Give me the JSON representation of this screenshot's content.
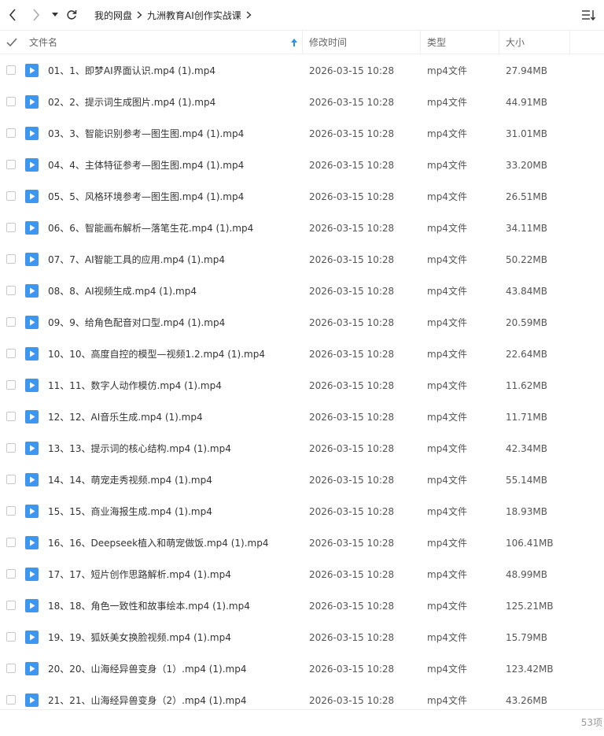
{
  "toolbar": {
    "breadcrumb": [
      "我的网盘",
      "九洲教育AI创作实战课"
    ]
  },
  "columns": {
    "name": "文件名",
    "modified": "修改时间",
    "type": "类型",
    "size": "大小"
  },
  "colors": {
    "accent": "#2b8ff0",
    "icon_blue": "#3e95f2"
  },
  "files": [
    {
      "name": "01、1、即梦AI界面认识.mp4 (1).mp4",
      "modified": "2026-03-15 10:28",
      "type": "mp4文件",
      "size": "27.94MB"
    },
    {
      "name": "02、2、提示词生成图片.mp4 (1).mp4",
      "modified": "2026-03-15 10:28",
      "type": "mp4文件",
      "size": "44.91MB"
    },
    {
      "name": "03、3、智能识别参考—图生图.mp4 (1).mp4",
      "modified": "2026-03-15 10:28",
      "type": "mp4文件",
      "size": "31.01MB"
    },
    {
      "name": "04、4、主体特征参考—图生图.mp4 (1).mp4",
      "modified": "2026-03-15 10:28",
      "type": "mp4文件",
      "size": "33.20MB"
    },
    {
      "name": "05、5、风格环境参考—图生图.mp4 (1).mp4",
      "modified": "2026-03-15 10:28",
      "type": "mp4文件",
      "size": "26.51MB"
    },
    {
      "name": "06、6、智能画布解析—落笔生花.mp4 (1).mp4",
      "modified": "2026-03-15 10:28",
      "type": "mp4文件",
      "size": "34.11MB"
    },
    {
      "name": "07、7、AI智能工具的应用.mp4 (1).mp4",
      "modified": "2026-03-15 10:28",
      "type": "mp4文件",
      "size": "50.22MB"
    },
    {
      "name": "08、8、AI视频生成.mp4 (1).mp4",
      "modified": "2026-03-15 10:28",
      "type": "mp4文件",
      "size": "43.84MB"
    },
    {
      "name": "09、9、给角色配音对口型.mp4 (1).mp4",
      "modified": "2026-03-15 10:28",
      "type": "mp4文件",
      "size": "20.59MB"
    },
    {
      "name": "10、10、高度自控的模型—视频1.2.mp4 (1).mp4",
      "modified": "2026-03-15 10:28",
      "type": "mp4文件",
      "size": "22.64MB"
    },
    {
      "name": "11、11、数字人动作模仿.mp4 (1).mp4",
      "modified": "2026-03-15 10:28",
      "type": "mp4文件",
      "size": "11.62MB"
    },
    {
      "name": "12、12、AI音乐生成.mp4 (1).mp4",
      "modified": "2026-03-15 10:28",
      "type": "mp4文件",
      "size": "11.71MB"
    },
    {
      "name": "13、13、提示词的核心结构.mp4 (1).mp4",
      "modified": "2026-03-15 10:28",
      "type": "mp4文件",
      "size": "42.34MB"
    },
    {
      "name": "14、14、萌宠走秀视频.mp4 (1).mp4",
      "modified": "2026-03-15 10:28",
      "type": "mp4文件",
      "size": "55.14MB"
    },
    {
      "name": "15、15、商业海报生成.mp4 (1).mp4",
      "modified": "2026-03-15 10:28",
      "type": "mp4文件",
      "size": "18.93MB"
    },
    {
      "name": "16、16、Deepseek植入和萌宠做饭.mp4 (1).mp4",
      "modified": "2026-03-15 10:28",
      "type": "mp4文件",
      "size": "106.41MB"
    },
    {
      "name": "17、17、短片创作思路解析.mp4 (1).mp4",
      "modified": "2026-03-15 10:28",
      "type": "mp4文件",
      "size": "48.99MB"
    },
    {
      "name": "18、18、角色一致性和故事绘本.mp4 (1).mp4",
      "modified": "2026-03-15 10:28",
      "type": "mp4文件",
      "size": "125.21MB"
    },
    {
      "name": "19、19、狐妖美女换脸视频.mp4 (1).mp4",
      "modified": "2026-03-15 10:28",
      "type": "mp4文件",
      "size": "15.79MB"
    },
    {
      "name": "20、20、山海经异兽变身（1）.mp4 (1).mp4",
      "modified": "2026-03-15 10:28",
      "type": "mp4文件",
      "size": "123.42MB"
    },
    {
      "name": "21、21、山海经异兽变身（2）.mp4 (1).mp4",
      "modified": "2026-03-15 10:28",
      "type": "mp4文件",
      "size": "43.26MB"
    }
  ],
  "footer": {
    "count": "53项"
  }
}
